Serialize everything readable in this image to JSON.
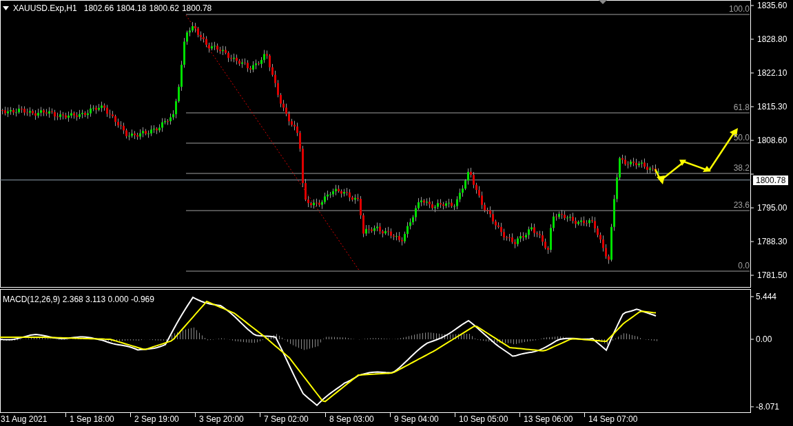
{
  "header": {
    "symbol": "XAUUSD.Exp,H1",
    "prices": [
      "1802.66",
      "1804.18",
      "1800.62",
      "1800.78"
    ]
  },
  "price_axis": [
    "1835.60",
    "1828.80",
    "1822.10",
    "1815.30",
    "1808.60",
    "1795.00",
    "1788.30",
    "1781.50"
  ],
  "current_price": "1800.78",
  "fibonacci_levels": [
    "100.0",
    "61.8",
    "50.0",
    "38.2",
    "23.6",
    "0.0"
  ],
  "macd": {
    "label": "MACD(12,26,9) 2.368 3.113 0.000 -0.969",
    "axis": [
      "5.444",
      "0.00",
      "-8.071"
    ]
  },
  "time_axis": [
    "31 Aug 2021",
    "1 Sep 18:00",
    "2 Sep 19:00",
    "3 Sep 20:00",
    "7 Sep 02:00",
    "8 Sep 03:00",
    "9 Sep 04:00",
    "10 Sep 05:00",
    "13 Sep 06:00",
    "14 Sep 07:00"
  ]
}
